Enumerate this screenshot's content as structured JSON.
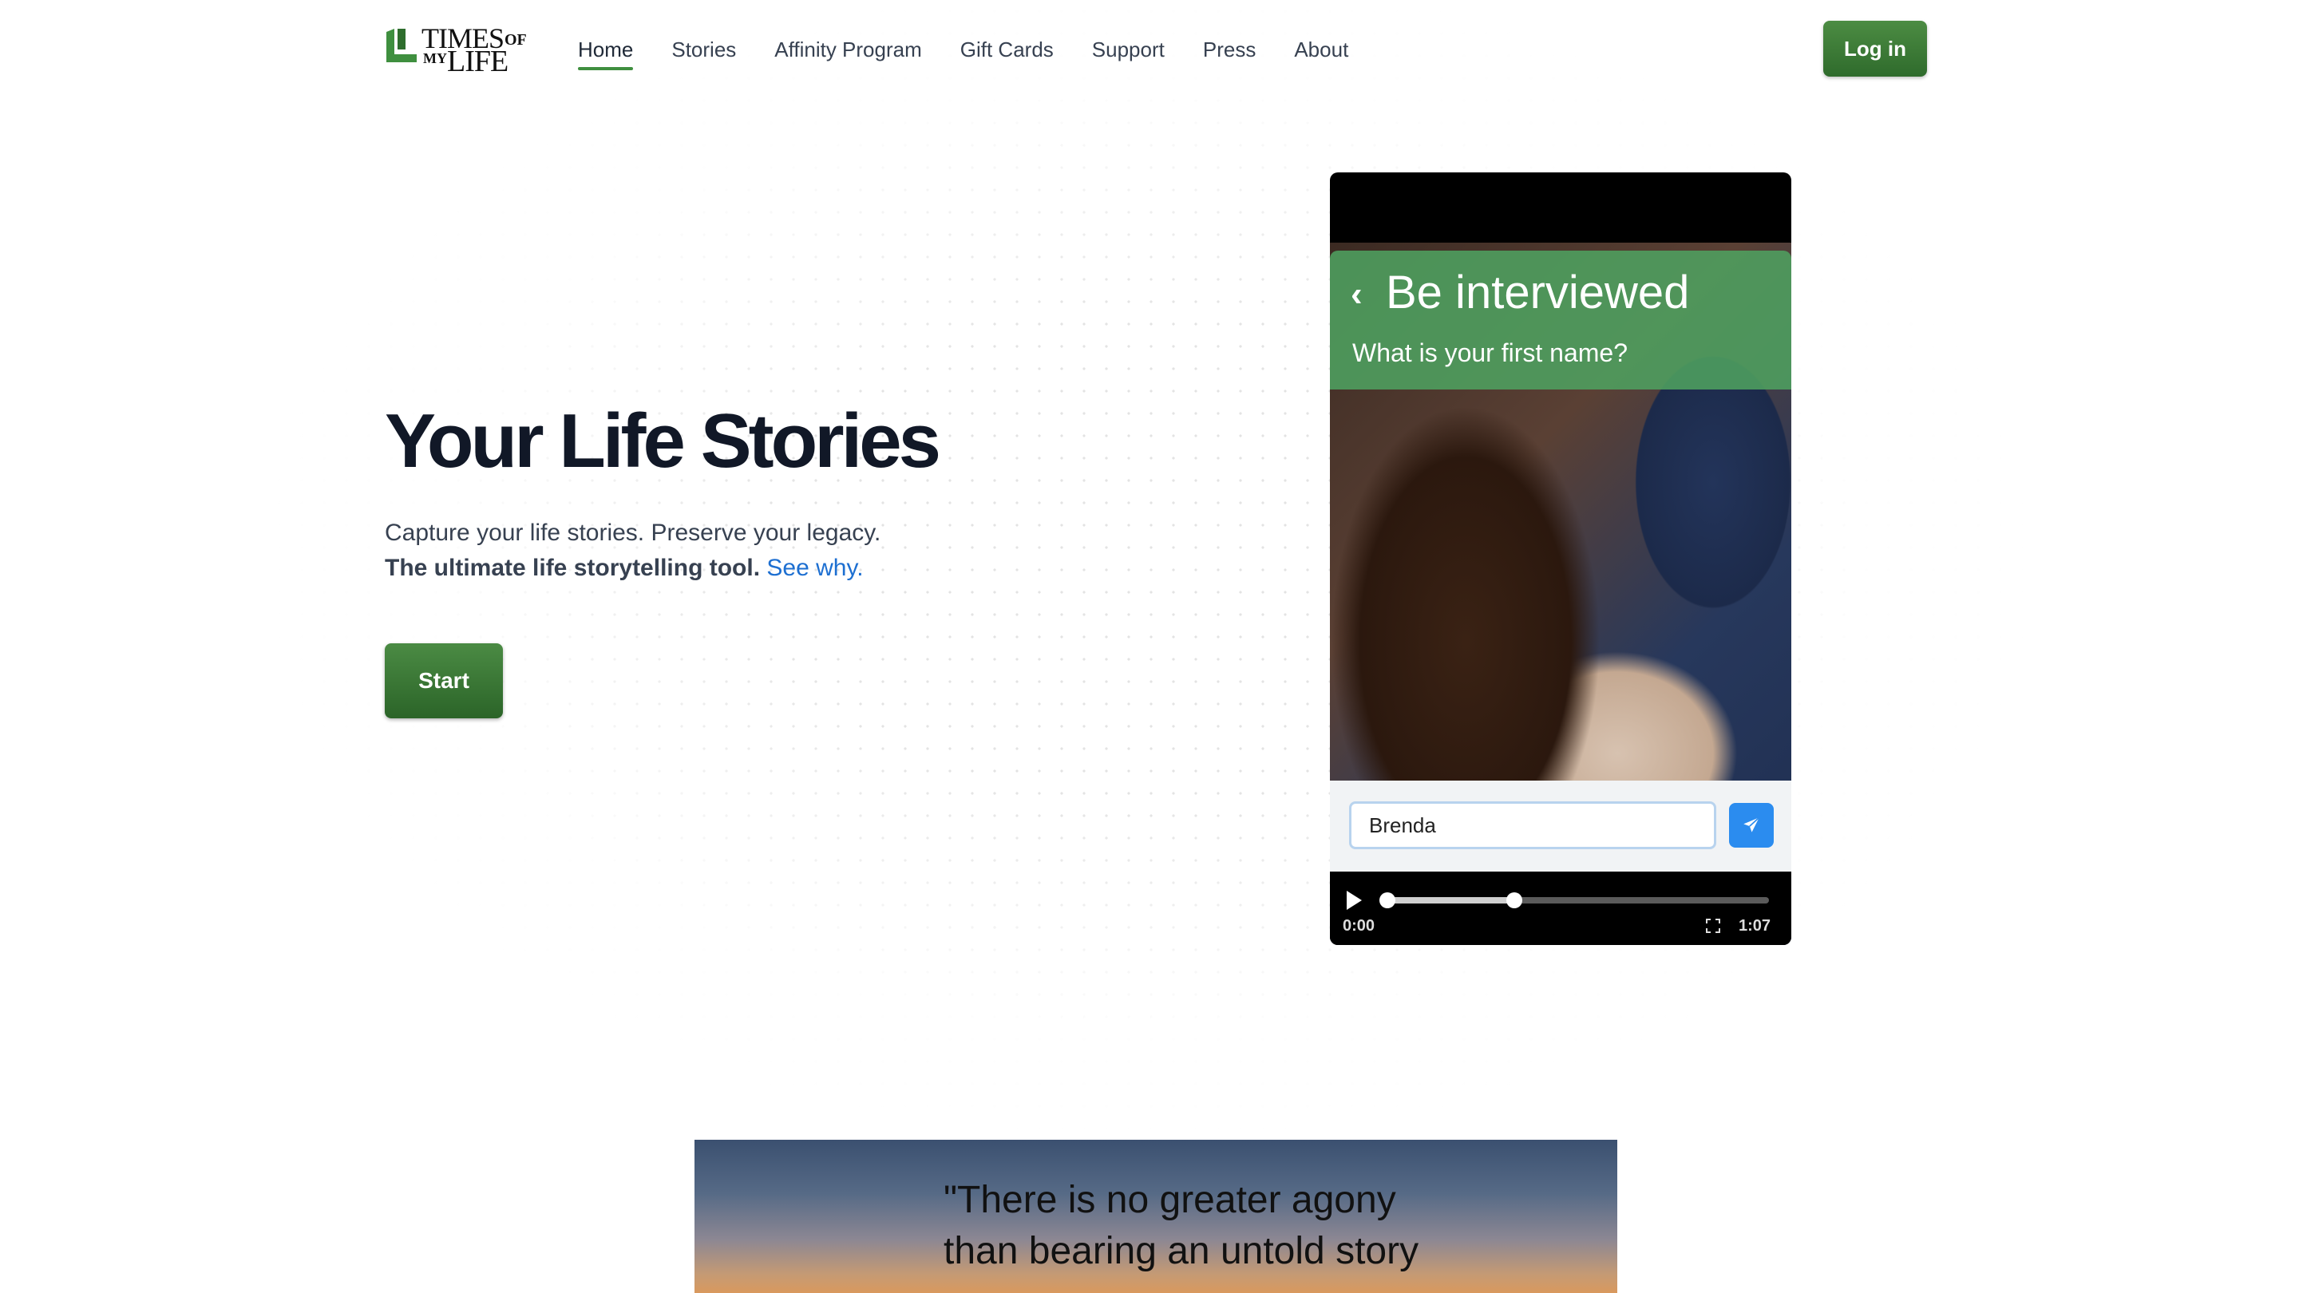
{
  "brand": {
    "name_line1": "TIMES",
    "name_of": "OF",
    "name_my": "MY",
    "name_line2": "LIFE",
    "accent_color": "#3f8f3f",
    "link_color": "#1d6fd1"
  },
  "nav": {
    "items": [
      {
        "label": "Home",
        "active": true
      },
      {
        "label": "Stories"
      },
      {
        "label": "Affinity Program"
      },
      {
        "label": "Gift Cards"
      },
      {
        "label": "Support"
      },
      {
        "label": "Press"
      },
      {
        "label": "About"
      }
    ],
    "login_label": "Log in"
  },
  "hero": {
    "title": "Your Life Stories",
    "subtitle": "Capture your life stories. Preserve your legacy.",
    "tagline_bold": "The ultimate life storytelling tool.",
    "see_why": "See why",
    "see_why_period": ".",
    "start_label": "Start"
  },
  "video": {
    "header_title": "Be interviewed",
    "back_icon": "chevron-left-icon",
    "question": "What is your first name?",
    "answer_value": "Brenda",
    "send_icon": "send-icon",
    "time_current": "0:00",
    "time_total": "1:07",
    "progress_fraction": 0.34,
    "buffered_fraction": 0.34
  },
  "quote": {
    "line1": "\"There is no greater agony",
    "line2": "than bearing an untold story"
  }
}
